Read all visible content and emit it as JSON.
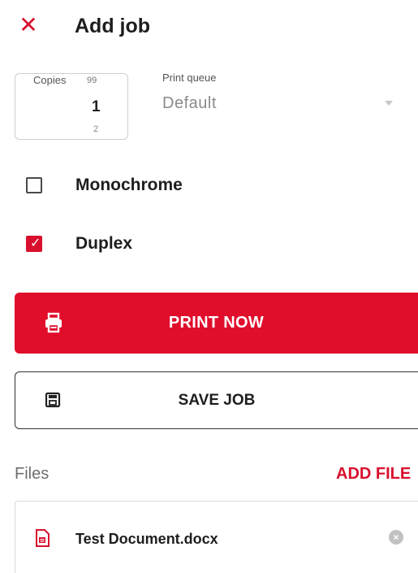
{
  "header": {
    "close_icon": "close-icon",
    "close_glyph": "✕",
    "title": "Add job"
  },
  "copies": {
    "label": "Copies",
    "max": "99",
    "value": "1",
    "min": "2"
  },
  "print_queue": {
    "label": "Print queue",
    "value": "Default"
  },
  "options": {
    "monochrome": {
      "label": "Monochrome",
      "checked": false
    },
    "duplex": {
      "label": "Duplex",
      "checked": true,
      "check_glyph": "✓"
    }
  },
  "actions": {
    "print_now": "PRINT NOW",
    "save_job": "SAVE JOB"
  },
  "files": {
    "label": "Files",
    "add_file": "ADD FILE",
    "items": [
      {
        "name": "Test Document.docx",
        "remove_glyph": "×"
      }
    ]
  },
  "colors": {
    "accent": "#e00d2b",
    "text": "#1e1e1e",
    "muted": "#6f6f6f"
  }
}
